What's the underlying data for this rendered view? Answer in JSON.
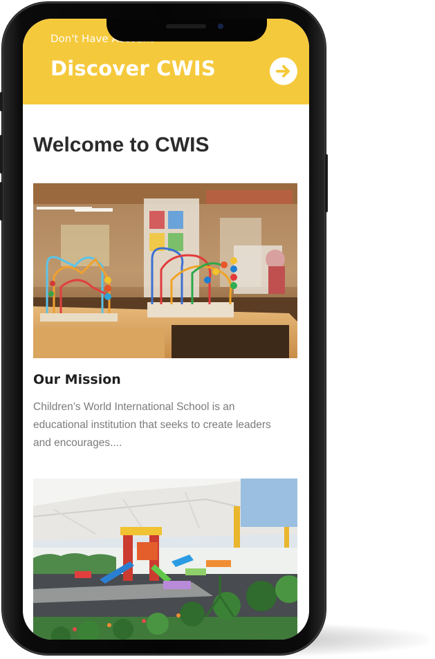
{
  "banner": {
    "kicker": "Don't Have Account",
    "title": "Discover CWIS",
    "arrow_icon": "arrow-right-circle-icon",
    "color": "#f5c93c"
  },
  "main": {
    "title": "Welcome to CWIS",
    "mission": {
      "heading": "Our Mission",
      "text": "Children’s World International School is an educational institution that seeks to create leaders and encourages...."
    }
  }
}
